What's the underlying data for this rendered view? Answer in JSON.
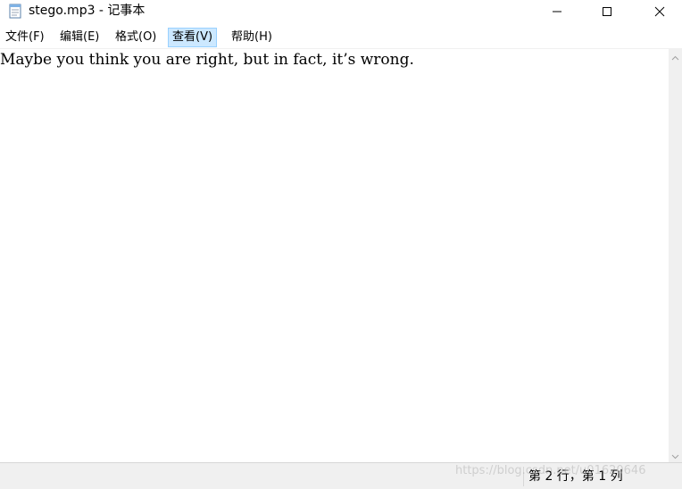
{
  "window": {
    "title": "stego.mp3 - 记事本",
    "icon": "notepad-icon",
    "controls": {
      "minimize_icon": "minimize-icon",
      "maximize_icon": "maximize-icon",
      "close_icon": "close-icon"
    }
  },
  "menubar": {
    "items": [
      {
        "label": "文件(F)"
      },
      {
        "label": "编辑(E)"
      },
      {
        "label": "格式(O)"
      },
      {
        "label": "查看(V)",
        "active": true
      },
      {
        "label": "帮助(H)"
      }
    ]
  },
  "editor": {
    "content": "Maybe you think you are right, but in fact, it’s wrong."
  },
  "statusbar": {
    "position": "第 2 行，第 1 列"
  },
  "watermark": {
    "text": "https://blog.csdn.net/u01620646"
  },
  "colors": {
    "menu_active_bg": "#cce8ff",
    "menu_active_border": "#99d1ff",
    "statusbar_bg": "#f0f0f0"
  }
}
